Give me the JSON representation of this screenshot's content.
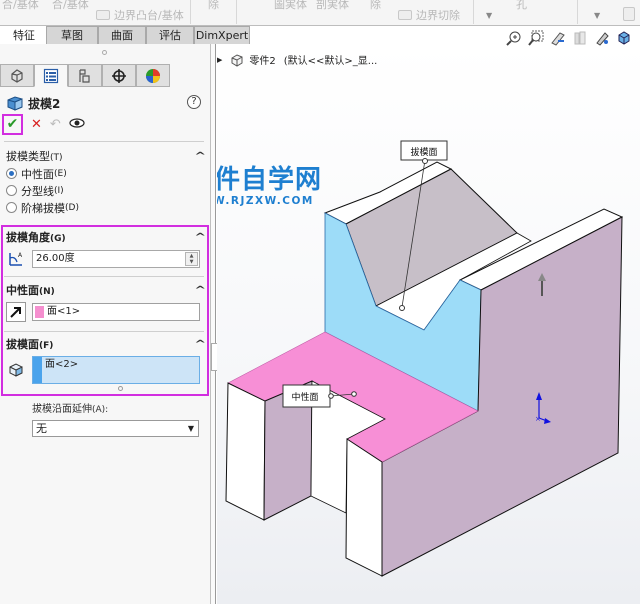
{
  "ribbon": {
    "items": [
      {
        "label": "合/基体",
        "faded": true
      },
      {
        "label": "合/基体",
        "faded": true
      },
      {
        "label": "边界凸台/基体",
        "faded": true
      },
      {
        "label": "除",
        "faded": true
      },
      {
        "label": "圖実体",
        "faded": true
      },
      {
        "label": "剖実体",
        "faded": true
      },
      {
        "label": "除",
        "faded": true
      },
      {
        "label": "边界切除",
        "faded": true
      },
      {
        "label": "孔",
        "faded": true
      }
    ]
  },
  "command_tabs": [
    {
      "label": "特征",
      "active": true
    },
    {
      "label": "草图",
      "active": false
    },
    {
      "label": "曲面",
      "active": false
    },
    {
      "label": "评估",
      "active": false
    },
    {
      "label": "DimXpert",
      "active": false
    }
  ],
  "panel": {
    "tabs": [
      {
        "icon": "feature-manager-icon"
      },
      {
        "icon": "property-manager-icon",
        "active": true
      },
      {
        "icon": "configuration-manager-icon"
      },
      {
        "icon": "dimxpert-manager-icon"
      },
      {
        "icon": "display-manager-icon"
      }
    ],
    "feature_name": "拔模2",
    "help": "?",
    "actions": {
      "ok": "✔",
      "cancel": "✕",
      "undo": "↶",
      "preview": "👁"
    },
    "draft_type": {
      "title": "拔模类型",
      "hotkey": "(T)",
      "options": [
        {
          "label": "中性面",
          "hotkey": "(E)",
          "selected": true
        },
        {
          "label": "分型线",
          "hotkey": "(I)",
          "selected": false
        },
        {
          "label": "阶梯拔模",
          "hotkey": "(D)",
          "selected": false
        }
      ]
    },
    "draft_angle": {
      "title": "拔模角度",
      "hotkey": "(G)",
      "value": "26.00度"
    },
    "neutral_plane": {
      "title": "中性面",
      "hotkey": "(N)",
      "value": "面<1>",
      "color": "#f58fcf"
    },
    "faces_to_draft": {
      "title": "拔模面",
      "hotkey": "(F)",
      "value": "面<2>",
      "color": "#4aa3ec"
    },
    "face_propagation": {
      "label": "拔模沿面延伸",
      "hotkey": "(A):",
      "value": "无"
    }
  },
  "viewport": {
    "tree": {
      "part": "零件2",
      "config": "(默认<<默认>_显..."
    },
    "watermark": {
      "title": "软件自学网",
      "url": "WWW.RJZXW.COM"
    },
    "callouts": {
      "draft_face": "拔模面",
      "neutral_face": "中性面"
    },
    "colors": {
      "neutral_face": "#f78fd6",
      "draft_face": "#9ddcf8",
      "body": "#c6b0c8",
      "body_dark": "#c7bfc8"
    }
  }
}
